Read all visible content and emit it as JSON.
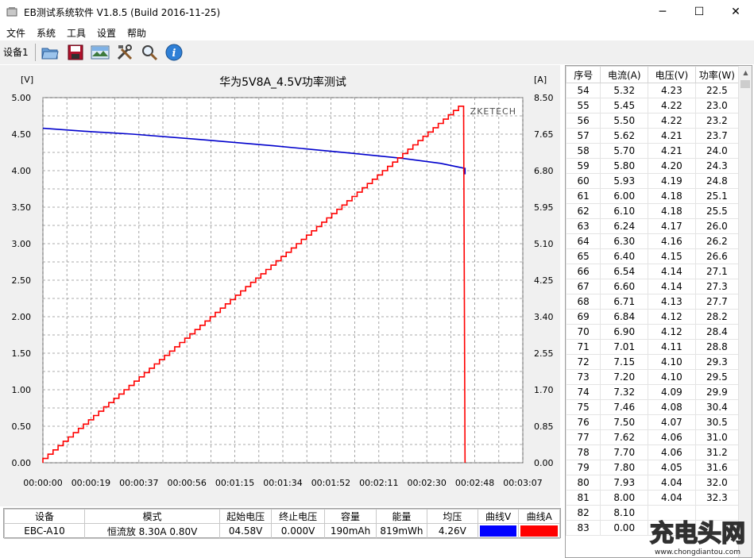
{
  "window": {
    "title": "EB测试系统软件 V1.8.5 (Build 2016-11-25)",
    "minimize": "─",
    "maximize": "☐",
    "close": "✕"
  },
  "menu": [
    "文件",
    "系统",
    "工具",
    "设置",
    "帮助"
  ],
  "toolbar": {
    "device_tab": "设备1",
    "buttons": [
      "open-folder-icon",
      "save-icon",
      "chart-image-icon",
      "tools-icon",
      "search-icon",
      "info-icon"
    ]
  },
  "chart_data": {
    "type": "line",
    "title": "华为5V8A_4.5V功率测试",
    "watermark": "ZKETECH",
    "y_left_unit": "[V]",
    "y_right_unit": "[A]",
    "y_left_ticks": [
      "5.00",
      "4.50",
      "4.00",
      "3.50",
      "3.00",
      "2.50",
      "2.00",
      "1.50",
      "1.00",
      "0.50",
      "0.00"
    ],
    "y_right_ticks": [
      "8.50",
      "7.65",
      "6.80",
      "5.95",
      "5.10",
      "4.25",
      "3.40",
      "2.55",
      "1.70",
      "0.85",
      "0.00"
    ],
    "x_ticks": [
      "00:00:00",
      "00:00:19",
      "00:00:37",
      "00:00:56",
      "00:01:15",
      "00:01:34",
      "00:01:52",
      "00:02:11",
      "00:02:30",
      "00:02:48",
      "00:03:07"
    ],
    "ylim_left": [
      0,
      5
    ],
    "ylim_right": [
      0,
      8.5
    ],
    "xlim_seconds": [
      0,
      187
    ],
    "series": [
      {
        "color": "#0000cc",
        "axis": "left",
        "x": [
          0,
          16,
          35,
          60,
          90,
          120,
          140,
          155,
          164.5,
          164.5
        ],
        "y": [
          4.58,
          4.54,
          4.5,
          4.43,
          4.34,
          4.24,
          4.17,
          4.1,
          4.03,
          3.95
        ]
      },
      {
        "color": "#ff0000",
        "axis": "right",
        "step_x0": 0,
        "step_dx": 1.975,
        "step_y0": 0.1,
        "step_dy": 0.1,
        "steps": 83,
        "end_x": 164.5,
        "end_y": 8.3,
        "drop_x": 164.5,
        "drop_y": 0.0
      }
    ]
  },
  "data_table": {
    "headers": [
      "序号",
      "电流(A)",
      "电压(V)",
      "功率(W)"
    ],
    "rows": [
      [
        "54",
        "5.32",
        "4.23",
        "22.5"
      ],
      [
        "55",
        "5.45",
        "4.22",
        "23.0"
      ],
      [
        "56",
        "5.50",
        "4.22",
        "23.2"
      ],
      [
        "57",
        "5.62",
        "4.21",
        "23.7"
      ],
      [
        "58",
        "5.70",
        "4.21",
        "24.0"
      ],
      [
        "59",
        "5.80",
        "4.20",
        "24.3"
      ],
      [
        "60",
        "5.93",
        "4.19",
        "24.8"
      ],
      [
        "61",
        "6.00",
        "4.18",
        "25.1"
      ],
      [
        "62",
        "6.10",
        "4.18",
        "25.5"
      ],
      [
        "63",
        "6.24",
        "4.17",
        "26.0"
      ],
      [
        "64",
        "6.30",
        "4.16",
        "26.2"
      ],
      [
        "65",
        "6.40",
        "4.15",
        "26.6"
      ],
      [
        "66",
        "6.54",
        "4.14",
        "27.1"
      ],
      [
        "67",
        "6.60",
        "4.14",
        "27.3"
      ],
      [
        "68",
        "6.71",
        "4.13",
        "27.7"
      ],
      [
        "69",
        "6.84",
        "4.12",
        "28.2"
      ],
      [
        "70",
        "6.90",
        "4.12",
        "28.4"
      ],
      [
        "71",
        "7.01",
        "4.11",
        "28.8"
      ],
      [
        "72",
        "7.15",
        "4.10",
        "29.3"
      ],
      [
        "73",
        "7.20",
        "4.10",
        "29.5"
      ],
      [
        "74",
        "7.32",
        "4.09",
        "29.9"
      ],
      [
        "75",
        "7.46",
        "4.08",
        "30.4"
      ],
      [
        "76",
        "7.50",
        "4.07",
        "30.5"
      ],
      [
        "77",
        "7.62",
        "4.06",
        "31.0"
      ],
      [
        "78",
        "7.70",
        "4.06",
        "31.2"
      ],
      [
        "79",
        "7.80",
        "4.05",
        "31.6"
      ],
      [
        "80",
        "7.93",
        "4.04",
        "32.0"
      ],
      [
        "81",
        "8.00",
        "4.04",
        "32.3"
      ],
      [
        "82",
        "8.10",
        "",
        ""
      ],
      [
        "83",
        "0.00",
        "",
        ""
      ]
    ]
  },
  "summary": {
    "headers": [
      "设备",
      "模式",
      "起始电压",
      "终止电压",
      "容量",
      "能量",
      "均压",
      "曲线V",
      "曲线A"
    ],
    "values": [
      "EBC-A10",
      "恒流放  8.30A  0.80V",
      "04.58V",
      "0.000V",
      "190mAh",
      "819mWh",
      "4.26V",
      "",
      ""
    ],
    "curve_v_color": "#0000ff",
    "curve_a_color": "#ff0000"
  },
  "watermark": {
    "logo": "充电头网",
    "url": "www.chongdiantou.com"
  }
}
